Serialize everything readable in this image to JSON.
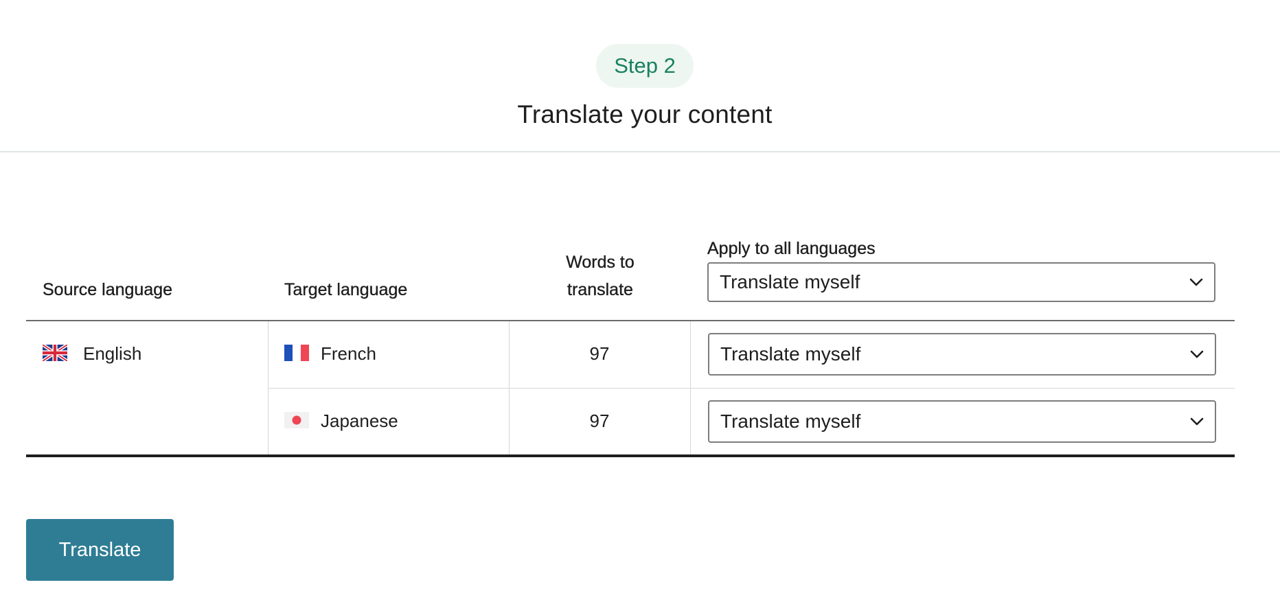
{
  "header": {
    "step": "Step 2",
    "title": "Translate your content"
  },
  "table": {
    "columns": {
      "source": "Source language",
      "target": "Target language",
      "words_line1": "Words to",
      "words_line2": "translate",
      "apply_all_label": "Apply to all languages"
    },
    "apply_all_value": "Translate myself",
    "source_language": "English",
    "rows": [
      {
        "target": "French",
        "words": "97",
        "method": "Translate myself"
      },
      {
        "target": "Japanese",
        "words": "97",
        "method": "Translate myself"
      }
    ]
  },
  "actions": {
    "translate_label": "Translate"
  },
  "colors": {
    "accent": "#2e7d94",
    "step_text": "#18805f",
    "step_bg": "#eef6f2"
  },
  "icons": {
    "source_flag": "uk-flag-icon",
    "french_flag": "france-flag-icon",
    "japanese_flag": "japan-flag-icon",
    "select_arrow": "chevron-down-icon"
  }
}
